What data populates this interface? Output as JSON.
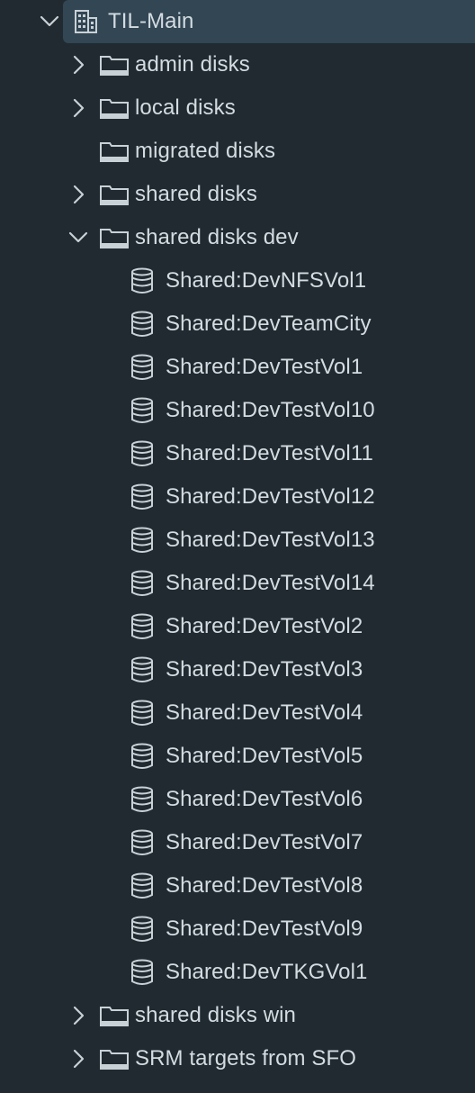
{
  "tree": {
    "root": {
      "label": "TIL-Main",
      "expanded": true,
      "icon": "datacenter-icon"
    },
    "folders": [
      {
        "label": "admin disks",
        "expandable": true,
        "expanded": false,
        "icon": "folder-icon"
      },
      {
        "label": "local disks",
        "expandable": true,
        "expanded": false,
        "icon": "folder-icon"
      },
      {
        "label": "migrated disks",
        "expandable": false,
        "expanded": false,
        "icon": "folder-icon"
      },
      {
        "label": "shared disks",
        "expandable": true,
        "expanded": false,
        "icon": "folder-icon"
      },
      {
        "label": "shared disks dev",
        "expandable": true,
        "expanded": true,
        "icon": "folder-icon"
      }
    ],
    "datastores": [
      "Shared:DevNFSVol1",
      "Shared:DevTeamCity",
      "Shared:DevTestVol1",
      "Shared:DevTestVol10",
      "Shared:DevTestVol11",
      "Shared:DevTestVol12",
      "Shared:DevTestVol13",
      "Shared:DevTestVol14",
      "Shared:DevTestVol2",
      "Shared:DevTestVol3",
      "Shared:DevTestVol4",
      "Shared:DevTestVol5",
      "Shared:DevTestVol6",
      "Shared:DevTestVol7",
      "Shared:DevTestVol8",
      "Shared:DevTestVol9",
      "Shared:DevTKGVol1"
    ],
    "trailing_folders": [
      {
        "label": "shared disks win",
        "expandable": true,
        "expanded": false,
        "icon": "folder-icon"
      },
      {
        "label": "SRM targets from SFO",
        "expandable": true,
        "expanded": false,
        "icon": "folder-icon"
      }
    ]
  },
  "colors": {
    "background": "#202a30",
    "selected_row": "#324654",
    "text": "#d4dce1",
    "icon": "#c8d1d6"
  }
}
